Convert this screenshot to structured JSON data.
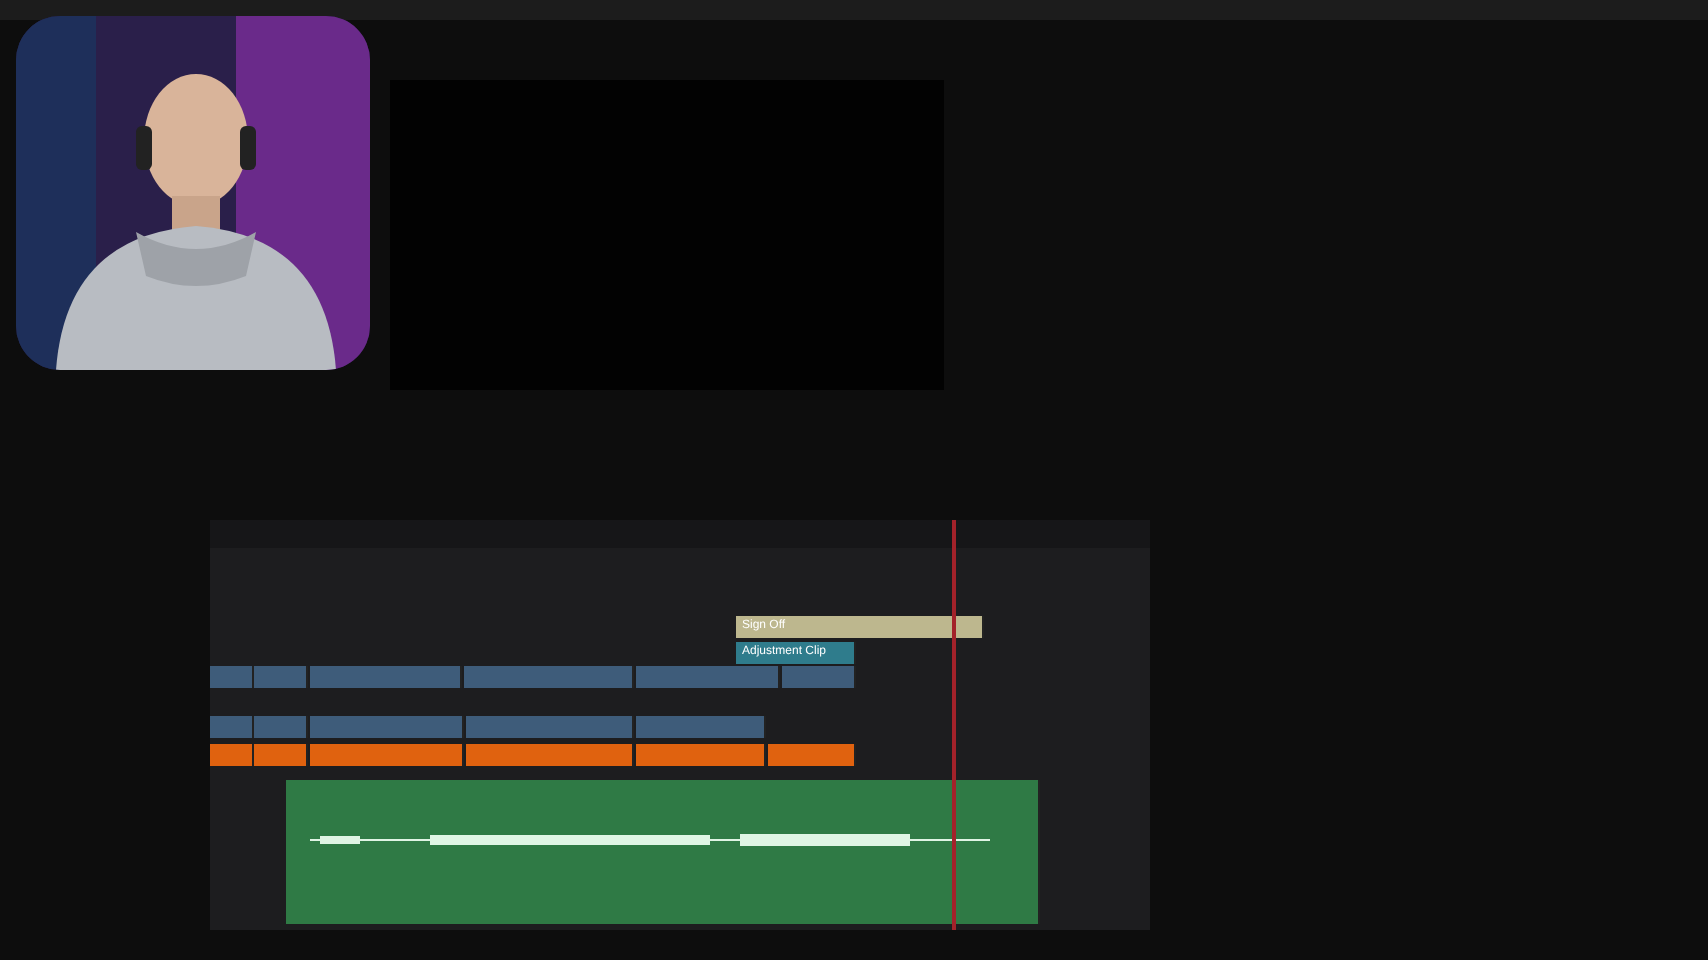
{
  "timeline": {
    "tracks": [
      {
        "clips": [
          {
            "label": "Sign Off",
            "color": "#bdb78e"
          }
        ]
      },
      {
        "clips": [
          {
            "label": "Adjustment Clip",
            "color": "#2f7c8c"
          }
        ]
      },
      {
        "clips": [
          {
            "color": "#3e5c7a"
          },
          {
            "color": "#3e5c7a"
          },
          {
            "color": "#3e5c7a"
          },
          {
            "color": "#3e5c7a"
          },
          {
            "color": "#3e5c7a"
          },
          {
            "color": "#3e5c7a"
          }
        ]
      },
      {
        "clips": [
          {
            "color": "#3e5c7a"
          },
          {
            "color": "#3e5c7a"
          },
          {
            "color": "#3e5c7a"
          },
          {
            "color": "#3e5c7a"
          },
          {
            "color": "#3e5c7a"
          }
        ]
      },
      {
        "clips": [
          {
            "color": "#e0620f"
          },
          {
            "color": "#e0620f"
          },
          {
            "color": "#e0620f"
          },
          {
            "color": "#e0620f"
          },
          {
            "color": "#e0620f"
          },
          {
            "color": "#e0620f"
          }
        ]
      },
      {
        "clips": [
          {
            "color": "#2f7a45",
            "kind": "audio"
          }
        ]
      }
    ]
  }
}
